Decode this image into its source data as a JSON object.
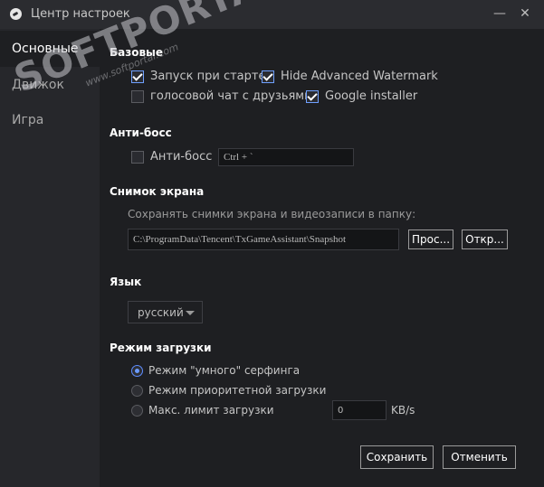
{
  "window": {
    "title": "Центр настроек",
    "minimize_icon": "—",
    "close_icon": "✕"
  },
  "sidebar": {
    "items": [
      {
        "label": "Основные",
        "active": true
      },
      {
        "label": "Движок",
        "active": false
      },
      {
        "label": "Игра",
        "active": false
      }
    ]
  },
  "basic": {
    "title": "Базовые",
    "autostart": {
      "label": "Запуск при старте",
      "checked": true
    },
    "hide_watermark": {
      "label": "Hide Advanced Watermark",
      "checked": true
    },
    "voice_chat": {
      "label": "голосовой чат с друзьями",
      "checked": false
    },
    "google_installer": {
      "label": "Google installer",
      "checked": true
    }
  },
  "antiboss": {
    "title": "Анти-босс",
    "checkbox_label": "Анти-босс",
    "checked": false,
    "hotkey": "Ctrl + `"
  },
  "screenshot": {
    "title": "Снимок экрана",
    "description": "Сохранять снимки экрана и видеозаписи в папку:",
    "path": "C:\\ProgramData\\Tencent\\TxGameAssistant\\Snapshot",
    "browse_label": "Прос...",
    "open_label": "Откр..."
  },
  "language": {
    "title": "Язык",
    "selected": "русский"
  },
  "download": {
    "title": "Режим загрузки",
    "options": [
      {
        "label": "Режим \"умного\" серфинга",
        "selected": true
      },
      {
        "label": "Режим приоритетной загрузки",
        "selected": false
      },
      {
        "label": "Макс. лимит загрузки",
        "selected": false
      }
    ],
    "limit_value": "0",
    "unit": "KB/s"
  },
  "footer": {
    "save_label": "Сохранить",
    "cancel_label": "Отменить"
  },
  "watermark": {
    "text": "SOFTPORTAL",
    "tm": "™",
    "url": "www.softportal.com"
  },
  "colors": {
    "accent": "#5d8cff",
    "background": "#1e1f22",
    "sidebar": "#26272b"
  }
}
